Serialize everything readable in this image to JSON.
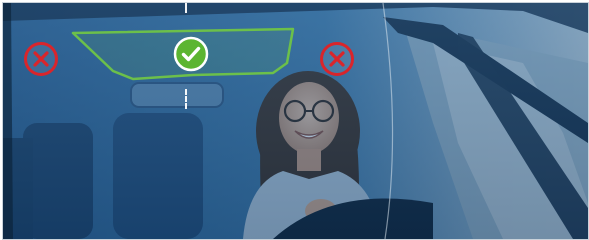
{
  "image": {
    "badges": [
      {
        "icon": "x-circle-icon",
        "status": "not-allowed",
        "color": "#d9252b"
      },
      {
        "icon": "check-circle-icon",
        "status": "allowed",
        "color": "#5cb531"
      },
      {
        "icon": "x-circle-icon",
        "status": "not-allowed",
        "color": "#d9252b"
      }
    ],
    "zone_outline_color": "#6cc04a",
    "guide_line_color": "#ffffff"
  }
}
